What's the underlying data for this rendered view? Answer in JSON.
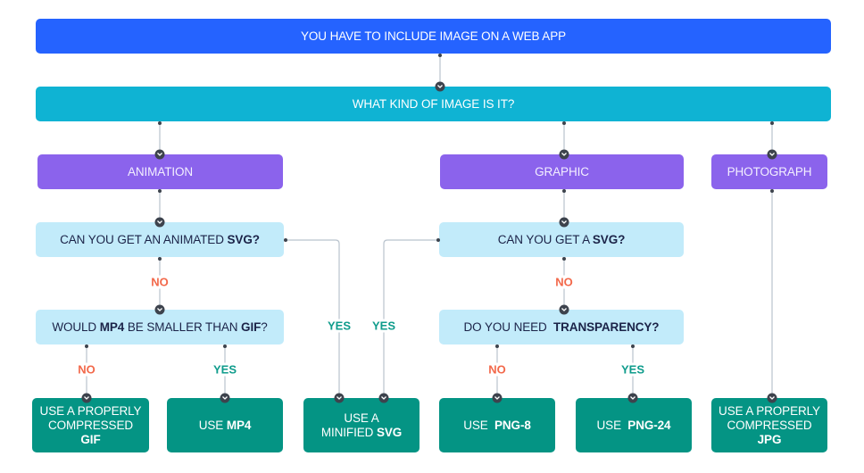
{
  "title": "YOU HAVE TO INCLUDE IMAGE ON A WEB APP",
  "question_kind": "WHAT KIND OF IMAGE IS IT?",
  "categories": {
    "animation": "ANIMATION",
    "graphic": "GRAPHIC",
    "photograph": "PHOTOGRAPH"
  },
  "questions": {
    "animated_svg": {
      "pre": "CAN YOU GET AN ANIMATED ",
      "bold": "SVG?"
    },
    "mp4_vs_gif": {
      "pre": "WOULD ",
      "bold1": "MP4",
      "mid": " BE SMALLER THAN ",
      "bold2": "GIF",
      "post": "?"
    },
    "svg": {
      "pre": "CAN YOU GET A ",
      "bold": "SVG?"
    },
    "transparency": {
      "pre": "DO YOU NEED  ",
      "bold": "TRANSPARENCY?"
    }
  },
  "results": {
    "gif": {
      "line1": "USE A PROPERLY",
      "line2": "COMPRESSED",
      "bold": "GIF"
    },
    "mp4": {
      "pre": "USE ",
      "bold": "MP4"
    },
    "svg": {
      "line1": "USE A",
      "pre": "MINIFIED ",
      "bold": "SVG"
    },
    "png8": {
      "pre": "USE  ",
      "bold": "PNG-8"
    },
    "png24": {
      "pre": "USE  ",
      "bold": "PNG-24"
    },
    "jpg": {
      "line1": "USE A PROPERLY",
      "line2": "COMPRESSED",
      "bold": "JPG"
    }
  },
  "edge_labels": {
    "animated_svg_no": "NO",
    "animated_svg_yes": "YES",
    "svg_yes": "YES",
    "svg_no": "NO",
    "mp4_no": "NO",
    "mp4_yes": "YES",
    "transparency_no": "NO",
    "transparency_yes": "YES"
  },
  "colors": {
    "start": "#2563ff",
    "kind": "#0fb3d3",
    "category": "#8b63ec",
    "question": "#c2ebfa",
    "result": "#049484",
    "no": "#f2684a",
    "yes": "#0f9c8c",
    "connector": "#b8c2cc"
  }
}
